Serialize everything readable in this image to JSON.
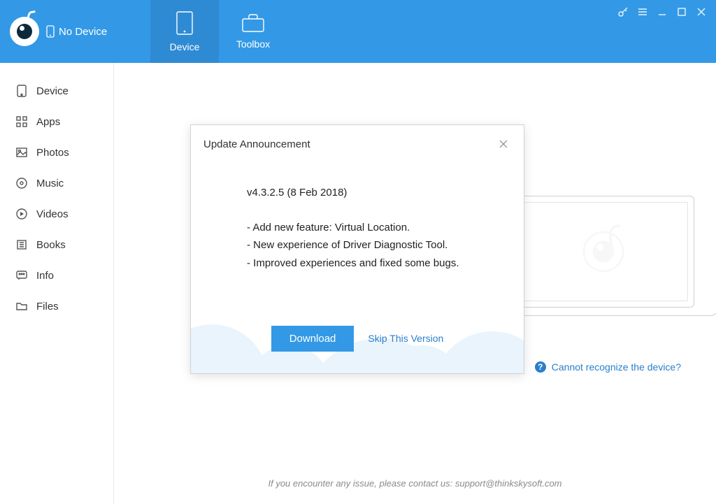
{
  "header": {
    "device_status": "No Device",
    "tabs": {
      "device": "Device",
      "toolbox": "Toolbox"
    }
  },
  "sidebar": {
    "items": [
      {
        "label": "Device"
      },
      {
        "label": "Apps"
      },
      {
        "label": "Photos"
      },
      {
        "label": "Music"
      },
      {
        "label": "Videos"
      },
      {
        "label": "Books"
      },
      {
        "label": "Info"
      },
      {
        "label": "Files"
      }
    ]
  },
  "help_link": "Cannot recognize the device?",
  "footer_text": "If you encounter any issue, please contact us: support@thinkskysoft.com",
  "modal": {
    "title": "Update Announcement",
    "version_line": "v4.3.2.5 (8 Feb 2018)",
    "notes": [
      "- Add new feature: Virtual Location.",
      "- New experience of Driver Diagnostic Tool.",
      "- Improved experiences and fixed some bugs."
    ],
    "download_label": "Download",
    "skip_label": "Skip This Version"
  }
}
